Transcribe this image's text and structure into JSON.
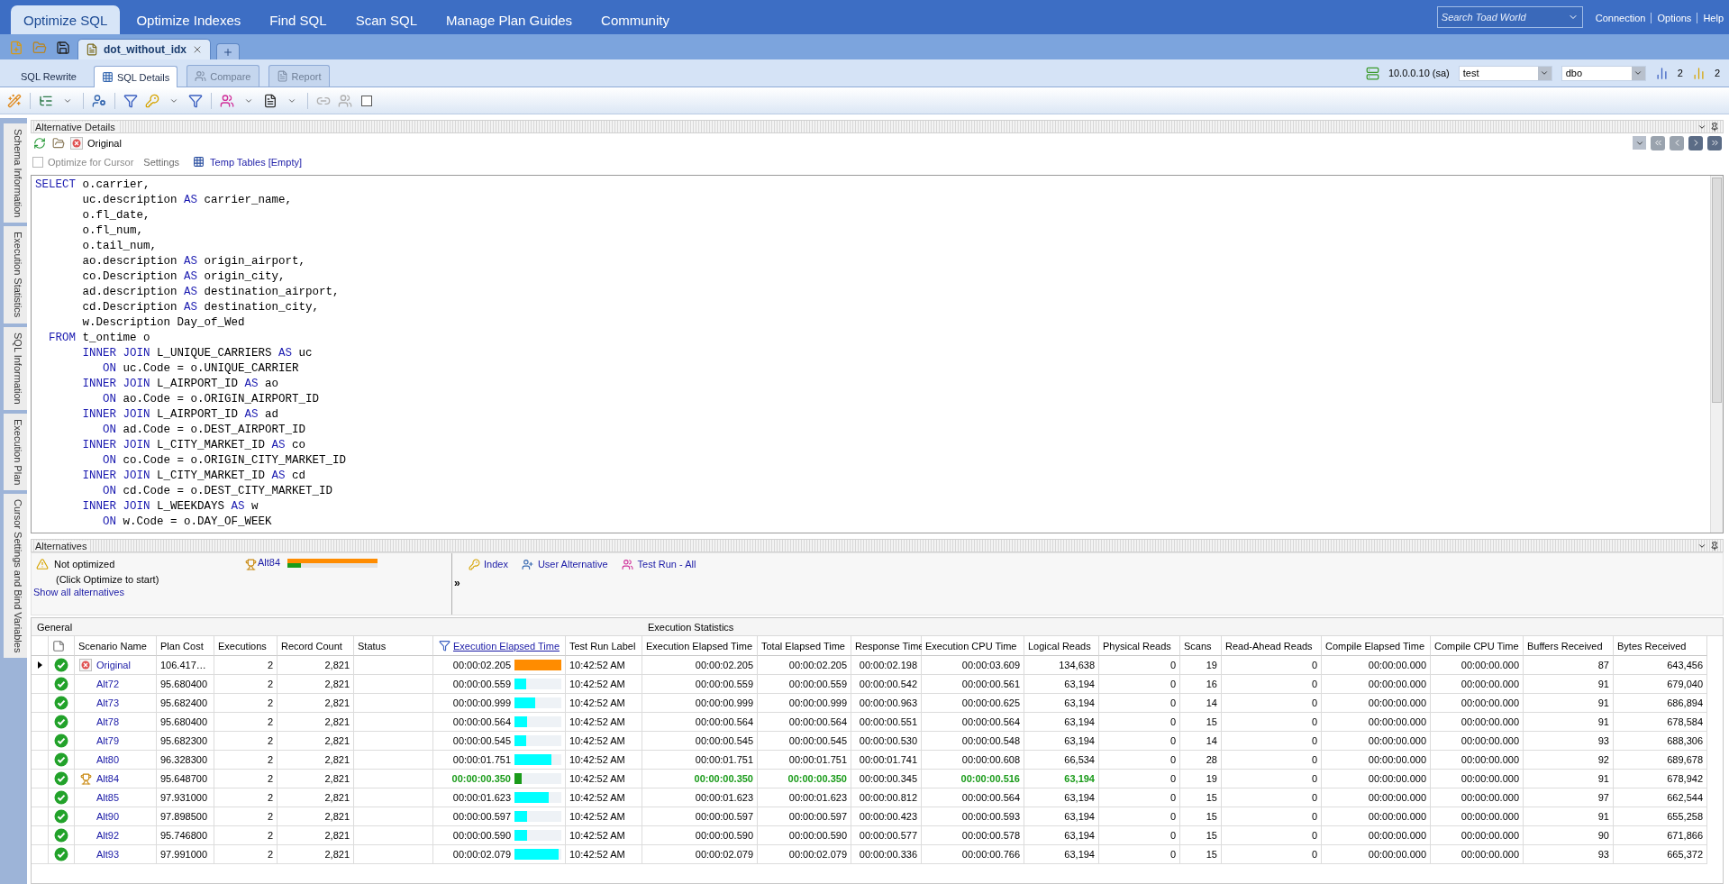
{
  "nav": {
    "tabs": [
      {
        "label": "Optimize SQL",
        "selected": true
      },
      {
        "label": "Optimize Indexes",
        "selected": false
      },
      {
        "label": "Find SQL",
        "selected": false
      },
      {
        "label": "Scan SQL",
        "selected": false
      },
      {
        "label": "Manage Plan Guides",
        "selected": false
      },
      {
        "label": "Community",
        "selected": false
      }
    ],
    "search": {
      "placeholder": "Search Toad World"
    },
    "links": [
      "Connection",
      "Options",
      "Help"
    ]
  },
  "document_tabs": [
    {
      "label": "dot_without_idx",
      "selected": true
    }
  ],
  "sub_tabs": [
    {
      "label": "SQL Rewrite",
      "kind": "label",
      "selected": false,
      "disabled": false
    },
    {
      "label": "SQL Details",
      "kind": "tab",
      "selected": true,
      "disabled": false
    },
    {
      "label": "Compare",
      "kind": "tab",
      "selected": false,
      "disabled": true
    },
    {
      "label": "Report",
      "kind": "tab",
      "selected": false,
      "disabled": true
    }
  ],
  "connection": {
    "server": "10.0.0.10 (sa)",
    "database": "test",
    "schema": "dbo",
    "counters": [
      "2",
      "2"
    ]
  },
  "side_tabs": [
    "Schema Information",
    "Execution Statistics",
    "SQL Information",
    "Execution Plan",
    "Cursor Settings and Bind Variables"
  ],
  "alternative_details": {
    "title": "Alternative Details",
    "scenario": "Original",
    "optimize_for_cursor": {
      "label": "Optimize for Cursor",
      "checked": false,
      "disabled": true
    },
    "settings": "Settings",
    "temp_tables": "Temp Tables [Empty]",
    "sql": [
      {
        "kind": "select",
        "segments": [
          {
            "text": "SELECT",
            "keyword": true
          },
          {
            "text": "o.carrier,",
            "keyword": false
          }
        ]
      },
      {
        "kind": "column",
        "segments": [
          {
            "text": "uc.description",
            "keyword": false
          },
          {
            "text": "AS",
            "keyword": true
          },
          {
            "text": "carrier_name,",
            "keyword": false
          }
        ]
      },
      {
        "kind": "column",
        "segments": [
          {
            "text": "o.fl_date,",
            "keyword": false
          }
        ]
      },
      {
        "kind": "column",
        "segments": [
          {
            "text": "o.fl_num,",
            "keyword": false
          }
        ]
      },
      {
        "kind": "column",
        "segments": [
          {
            "text": "o.tail_num,",
            "keyword": false
          }
        ]
      },
      {
        "kind": "column",
        "segments": [
          {
            "text": "ao.description",
            "keyword": false
          },
          {
            "text": "AS",
            "keyword": true
          },
          {
            "text": "origin_airport,",
            "keyword": false
          }
        ]
      },
      {
        "kind": "column",
        "segments": [
          {
            "text": "co.Description",
            "keyword": false
          },
          {
            "text": "AS",
            "keyword": true
          },
          {
            "text": "origin_city,",
            "keyword": false
          }
        ]
      },
      {
        "kind": "column",
        "segments": [
          {
            "text": "ad.description",
            "keyword": false
          },
          {
            "text": "AS",
            "keyword": true
          },
          {
            "text": "destination_airport,",
            "keyword": false
          }
        ]
      },
      {
        "kind": "column",
        "segments": [
          {
            "text": "cd.Description",
            "keyword": false
          },
          {
            "text": "AS",
            "keyword": true
          },
          {
            "text": "destination_city,",
            "keyword": false
          }
        ]
      },
      {
        "kind": "column",
        "segments": [
          {
            "text": "w.Description Day_of_Wed",
            "keyword": false
          }
        ]
      },
      {
        "kind": "from",
        "segments": [
          {
            "text": "FROM",
            "keyword": true
          },
          {
            "text": "t_ontime o",
            "keyword": false
          }
        ]
      },
      {
        "kind": "join",
        "segments": [
          {
            "text": "INNER JOIN",
            "keyword": true
          },
          {
            "text": "L_UNIQUE_CARRIERS",
            "keyword": false
          },
          {
            "text": "AS",
            "keyword": true
          },
          {
            "text": "uc",
            "keyword": false
          }
        ]
      },
      {
        "kind": "on",
        "segments": [
          {
            "text": "ON",
            "keyword": true
          },
          {
            "text": "uc.Code = o.UNIQUE_CARRIER",
            "keyword": false
          }
        ]
      },
      {
        "kind": "join",
        "segments": [
          {
            "text": "INNER JOIN",
            "keyword": true
          },
          {
            "text": "L_AIRPORT_ID",
            "keyword": false
          },
          {
            "text": "AS",
            "keyword": true
          },
          {
            "text": "ao",
            "keyword": false
          }
        ]
      },
      {
        "kind": "on",
        "segments": [
          {
            "text": "ON",
            "keyword": true
          },
          {
            "text": "ao.Code = o.ORIGIN_AIRPORT_ID",
            "keyword": false
          }
        ]
      },
      {
        "kind": "join",
        "segments": [
          {
            "text": "INNER JOIN",
            "keyword": true
          },
          {
            "text": "L_AIRPORT_ID",
            "keyword": false
          },
          {
            "text": "AS",
            "keyword": true
          },
          {
            "text": "ad",
            "keyword": false
          }
        ]
      },
      {
        "kind": "on",
        "segments": [
          {
            "text": "ON",
            "keyword": true
          },
          {
            "text": "ad.Code = o.DEST_AIRPORT_ID",
            "keyword": false
          }
        ]
      },
      {
        "kind": "join",
        "segments": [
          {
            "text": "INNER JOIN",
            "keyword": true
          },
          {
            "text": "L_CITY_MARKET_ID",
            "keyword": false
          },
          {
            "text": "AS",
            "keyword": true
          },
          {
            "text": "co",
            "keyword": false
          }
        ]
      },
      {
        "kind": "on",
        "segments": [
          {
            "text": "ON",
            "keyword": true
          },
          {
            "text": "co.Code = o.ORIGIN_CITY_MARKET_ID",
            "keyword": false
          }
        ]
      },
      {
        "kind": "join",
        "segments": [
          {
            "text": "INNER JOIN",
            "keyword": true
          },
          {
            "text": "L_CITY_MARKET_ID",
            "keyword": false
          },
          {
            "text": "AS",
            "keyword": true
          },
          {
            "text": "cd",
            "keyword": false
          }
        ]
      },
      {
        "kind": "on",
        "segments": [
          {
            "text": "ON",
            "keyword": true
          },
          {
            "text": "cd.Code = o.DEST_CITY_MARKET_ID",
            "keyword": false
          }
        ]
      },
      {
        "kind": "join",
        "segments": [
          {
            "text": "INNER JOIN",
            "keyword": true
          },
          {
            "text": "L_WEEKDAYS",
            "keyword": false
          },
          {
            "text": "AS",
            "keyword": true
          },
          {
            "text": "w",
            "keyword": false
          }
        ]
      },
      {
        "kind": "on",
        "segments": [
          {
            "text": "ON",
            "keyword": true
          },
          {
            "text": "w.Code = o.DAY_OF_WEEK",
            "keyword": false
          }
        ]
      }
    ]
  },
  "alternatives": {
    "title": "Alternatives",
    "status": "Not optimized",
    "hint": "(Click Optimize to start)",
    "show_all": "Show all alternatives",
    "best": {
      "label": "Alt84",
      "bars": [
        {
          "level": 1,
          "color": "#ff8c00"
        },
        {
          "level": 0.15,
          "color": "#1a9b1a"
        }
      ]
    },
    "more": "»",
    "actions": [
      "Index",
      "User Alternative",
      "Test Run - All"
    ]
  },
  "table": {
    "groups": [
      {
        "label": "General",
        "columns": [
          {
            "label": "Scenario Name",
            "kind": "plain"
          },
          {
            "label": "Plan Cost",
            "kind": "plain"
          },
          {
            "label": "Executions",
            "kind": "plain"
          },
          {
            "label": "Record Count",
            "kind": "plain"
          },
          {
            "label": "Status",
            "kind": "plain"
          },
          {
            "label": "Execution Elapsed Time",
            "kind": "sort_link"
          },
          {
            "label": "Test Run Label",
            "kind": "plain"
          }
        ]
      },
      {
        "label": "Execution Statistics",
        "columns": [
          {
            "label": "Execution Elapsed Time",
            "kind": "plain"
          },
          {
            "label": "Total Elapsed Time",
            "kind": "plain"
          },
          {
            "label": "Response Time",
            "kind": "plain"
          },
          {
            "label": "Execution CPU Time",
            "kind": "plain"
          },
          {
            "label": "Logical Reads",
            "kind": "plain"
          },
          {
            "label": "Physical Reads",
            "kind": "plain"
          },
          {
            "label": "Scans",
            "kind": "plain"
          },
          {
            "label": "Read-Ahead Reads",
            "kind": "plain"
          },
          {
            "label": "Compile Elapsed Time",
            "kind": "plain"
          },
          {
            "label": "Compile CPU Time",
            "kind": "plain"
          },
          {
            "label": "Buffers Received",
            "kind": "plain"
          },
          {
            "label": "Bytes Received",
            "kind": "plain"
          }
        ]
      }
    ],
    "rows": [
      {
        "selected": true,
        "kind": "original",
        "name": "Original",
        "plan_cost": "106.417…",
        "executions": "2",
        "record_count": "2,821",
        "elapsed": "00:00:02.205",
        "level": 1,
        "color": "#ff8c00",
        "best": false,
        "test_run_label": "10:42:52 AM",
        "stats": [
          {
            "value": "00:00:02.205",
            "best": false
          },
          {
            "value": "00:00:02.205",
            "best": false
          },
          {
            "value": "00:00:02.198",
            "best": false
          },
          {
            "value": "00:00:03.609",
            "best": false
          },
          {
            "value": "134,638",
            "best": false
          },
          {
            "value": "0",
            "best": false
          },
          {
            "value": "19",
            "best": false
          },
          {
            "value": "0",
            "best": false
          },
          {
            "value": "00:00:00.000",
            "best": false
          },
          {
            "value": "00:00:00.000",
            "best": false
          },
          {
            "value": "87",
            "best": false
          },
          {
            "value": "643,456",
            "best": false
          }
        ]
      },
      {
        "selected": false,
        "kind": "alternative",
        "name": "Alt72",
        "plan_cost": "95.680400",
        "executions": "2",
        "record_count": "2,821",
        "elapsed": "00:00:00.559",
        "level": 0.25,
        "color": "#00ffff",
        "best": false,
        "test_run_label": "10:42:52 AM",
        "stats": [
          {
            "value": "00:00:00.559",
            "best": false
          },
          {
            "value": "00:00:00.559",
            "best": false
          },
          {
            "value": "00:00:00.542",
            "best": false
          },
          {
            "value": "00:00:00.561",
            "best": false
          },
          {
            "value": "63,194",
            "best": false
          },
          {
            "value": "0",
            "best": false
          },
          {
            "value": "16",
            "best": false
          },
          {
            "value": "0",
            "best": false
          },
          {
            "value": "00:00:00.000",
            "best": false
          },
          {
            "value": "00:00:00.000",
            "best": false
          },
          {
            "value": "91",
            "best": false
          },
          {
            "value": "679,040",
            "best": false
          }
        ]
      },
      {
        "selected": false,
        "kind": "alternative",
        "name": "Alt73",
        "plan_cost": "95.682400",
        "executions": "2",
        "record_count": "2,821",
        "elapsed": "00:00:00.999",
        "level": 0.45,
        "color": "#00ffff",
        "best": false,
        "test_run_label": "10:42:52 AM",
        "stats": [
          {
            "value": "00:00:00.999",
            "best": false
          },
          {
            "value": "00:00:00.999",
            "best": false
          },
          {
            "value": "00:00:00.963",
            "best": false
          },
          {
            "value": "00:00:00.625",
            "best": false
          },
          {
            "value": "63,194",
            "best": false
          },
          {
            "value": "0",
            "best": false
          },
          {
            "value": "14",
            "best": false
          },
          {
            "value": "0",
            "best": false
          },
          {
            "value": "00:00:00.000",
            "best": false
          },
          {
            "value": "00:00:00.000",
            "best": false
          },
          {
            "value": "91",
            "best": false
          },
          {
            "value": "686,894",
            "best": false
          }
        ]
      },
      {
        "selected": false,
        "kind": "alternative",
        "name": "Alt78",
        "plan_cost": "95.680400",
        "executions": "2",
        "record_count": "2,821",
        "elapsed": "00:00:00.564",
        "level": 0.26,
        "color": "#00ffff",
        "best": false,
        "test_run_label": "10:42:52 AM",
        "stats": [
          {
            "value": "00:00:00.564",
            "best": false
          },
          {
            "value": "00:00:00.564",
            "best": false
          },
          {
            "value": "00:00:00.551",
            "best": false
          },
          {
            "value": "00:00:00.564",
            "best": false
          },
          {
            "value": "63,194",
            "best": false
          },
          {
            "value": "0",
            "best": false
          },
          {
            "value": "15",
            "best": false
          },
          {
            "value": "0",
            "best": false
          },
          {
            "value": "00:00:00.000",
            "best": false
          },
          {
            "value": "00:00:00.000",
            "best": false
          },
          {
            "value": "91",
            "best": false
          },
          {
            "value": "678,584",
            "best": false
          }
        ]
      },
      {
        "selected": false,
        "kind": "alternative",
        "name": "Alt79",
        "plan_cost": "95.682300",
        "executions": "2",
        "record_count": "2,821",
        "elapsed": "00:00:00.545",
        "level": 0.25,
        "color": "#00ffff",
        "best": false,
        "test_run_label": "10:42:52 AM",
        "stats": [
          {
            "value": "00:00:00.545",
            "best": false
          },
          {
            "value": "00:00:00.545",
            "best": false
          },
          {
            "value": "00:00:00.530",
            "best": false
          },
          {
            "value": "00:00:00.548",
            "best": false
          },
          {
            "value": "63,194",
            "best": false
          },
          {
            "value": "0",
            "best": false
          },
          {
            "value": "14",
            "best": false
          },
          {
            "value": "0",
            "best": false
          },
          {
            "value": "00:00:00.000",
            "best": false
          },
          {
            "value": "00:00:00.000",
            "best": false
          },
          {
            "value": "93",
            "best": false
          },
          {
            "value": "688,306",
            "best": false
          }
        ]
      },
      {
        "selected": false,
        "kind": "alternative",
        "name": "Alt80",
        "plan_cost": "96.328300",
        "executions": "2",
        "record_count": "2,821",
        "elapsed": "00:00:01.751",
        "level": 0.79,
        "color": "#00ffff",
        "best": false,
        "test_run_label": "10:42:52 AM",
        "stats": [
          {
            "value": "00:00:01.751",
            "best": false
          },
          {
            "value": "00:00:01.751",
            "best": false
          },
          {
            "value": "00:00:01.741",
            "best": false
          },
          {
            "value": "00:00:00.608",
            "best": false
          },
          {
            "value": "66,534",
            "best": false
          },
          {
            "value": "0",
            "best": false
          },
          {
            "value": "28",
            "best": false
          },
          {
            "value": "0",
            "best": false
          },
          {
            "value": "00:00:00.000",
            "best": false
          },
          {
            "value": "00:00:00.000",
            "best": false
          },
          {
            "value": "92",
            "best": false
          },
          {
            "value": "689,678",
            "best": false
          }
        ]
      },
      {
        "selected": false,
        "kind": "best",
        "name": "Alt84",
        "plan_cost": "95.648700",
        "executions": "2",
        "record_count": "2,821",
        "elapsed": "00:00:00.350",
        "level": 0.16,
        "color": "#1a9b1a",
        "best": true,
        "test_run_label": "10:42:52 AM",
        "stats": [
          {
            "value": "00:00:00.350",
            "best": true
          },
          {
            "value": "00:00:00.350",
            "best": true
          },
          {
            "value": "00:00:00.345",
            "best": false
          },
          {
            "value": "00:00:00.516",
            "best": true
          },
          {
            "value": "63,194",
            "best": true
          },
          {
            "value": "0",
            "best": false
          },
          {
            "value": "19",
            "best": false
          },
          {
            "value": "0",
            "best": false
          },
          {
            "value": "00:00:00.000",
            "best": false
          },
          {
            "value": "00:00:00.000",
            "best": false
          },
          {
            "value": "91",
            "best": false
          },
          {
            "value": "678,942",
            "best": false
          }
        ]
      },
      {
        "selected": false,
        "kind": "alternative",
        "name": "Alt85",
        "plan_cost": "97.931000",
        "executions": "2",
        "record_count": "2,821",
        "elapsed": "00:00:01.623",
        "level": 0.74,
        "color": "#00ffff",
        "best": false,
        "test_run_label": "10:42:52 AM",
        "stats": [
          {
            "value": "00:00:01.623",
            "best": false
          },
          {
            "value": "00:00:01.623",
            "best": false
          },
          {
            "value": "00:00:00.812",
            "best": false
          },
          {
            "value": "00:00:00.564",
            "best": false
          },
          {
            "value": "63,194",
            "best": false
          },
          {
            "value": "0",
            "best": false
          },
          {
            "value": "15",
            "best": false
          },
          {
            "value": "0",
            "best": false
          },
          {
            "value": "00:00:00.000",
            "best": false
          },
          {
            "value": "00:00:00.000",
            "best": false
          },
          {
            "value": "97",
            "best": false
          },
          {
            "value": "662,544",
            "best": false
          }
        ]
      },
      {
        "selected": false,
        "kind": "alternative",
        "name": "Alt90",
        "plan_cost": "97.898500",
        "executions": "2",
        "record_count": "2,821",
        "elapsed": "00:00:00.597",
        "level": 0.27,
        "color": "#00ffff",
        "best": false,
        "test_run_label": "10:42:52 AM",
        "stats": [
          {
            "value": "00:00:00.597",
            "best": false
          },
          {
            "value": "00:00:00.597",
            "best": false
          },
          {
            "value": "00:00:00.423",
            "best": false
          },
          {
            "value": "00:00:00.593",
            "best": false
          },
          {
            "value": "63,194",
            "best": false
          },
          {
            "value": "0",
            "best": false
          },
          {
            "value": "15",
            "best": false
          },
          {
            "value": "0",
            "best": false
          },
          {
            "value": "00:00:00.000",
            "best": false
          },
          {
            "value": "00:00:00.000",
            "best": false
          },
          {
            "value": "91",
            "best": false
          },
          {
            "value": "655,258",
            "best": false
          }
        ]
      },
      {
        "selected": false,
        "kind": "alternative",
        "name": "Alt92",
        "plan_cost": "95.746800",
        "executions": "2",
        "record_count": "2,821",
        "elapsed": "00:00:00.590",
        "level": 0.27,
        "color": "#00ffff",
        "best": false,
        "test_run_label": "10:42:52 AM",
        "stats": [
          {
            "value": "00:00:00.590",
            "best": false
          },
          {
            "value": "00:00:00.590",
            "best": false
          },
          {
            "value": "00:00:00.577",
            "best": false
          },
          {
            "value": "00:00:00.578",
            "best": false
          },
          {
            "value": "63,194",
            "best": false
          },
          {
            "value": "0",
            "best": false
          },
          {
            "value": "15",
            "best": false
          },
          {
            "value": "0",
            "best": false
          },
          {
            "value": "00:00:00.000",
            "best": false
          },
          {
            "value": "00:00:00.000",
            "best": false
          },
          {
            "value": "90",
            "best": false
          },
          {
            "value": "671,866",
            "best": false
          }
        ]
      },
      {
        "selected": false,
        "kind": "alternative",
        "name": "Alt93",
        "plan_cost": "97.991000",
        "executions": "2",
        "record_count": "2,821",
        "elapsed": "00:00:02.079",
        "level": 0.94,
        "color": "#00ffff",
        "best": false,
        "test_run_label": "10:42:52 AM",
        "stats": [
          {
            "value": "00:00:02.079",
            "best": false
          },
          {
            "value": "00:00:02.079",
            "best": false
          },
          {
            "value": "00:00:00.336",
            "best": false
          },
          {
            "value": "00:00:00.766",
            "best": false
          },
          {
            "value": "63,194",
            "best": false
          },
          {
            "value": "0",
            "best": false
          },
          {
            "value": "15",
            "best": false
          },
          {
            "value": "0",
            "best": false
          },
          {
            "value": "00:00:00.000",
            "best": false
          },
          {
            "value": "00:00:00.000",
            "best": false
          },
          {
            "value": "93",
            "best": false
          },
          {
            "value": "665,372",
            "best": false
          }
        ]
      }
    ]
  }
}
